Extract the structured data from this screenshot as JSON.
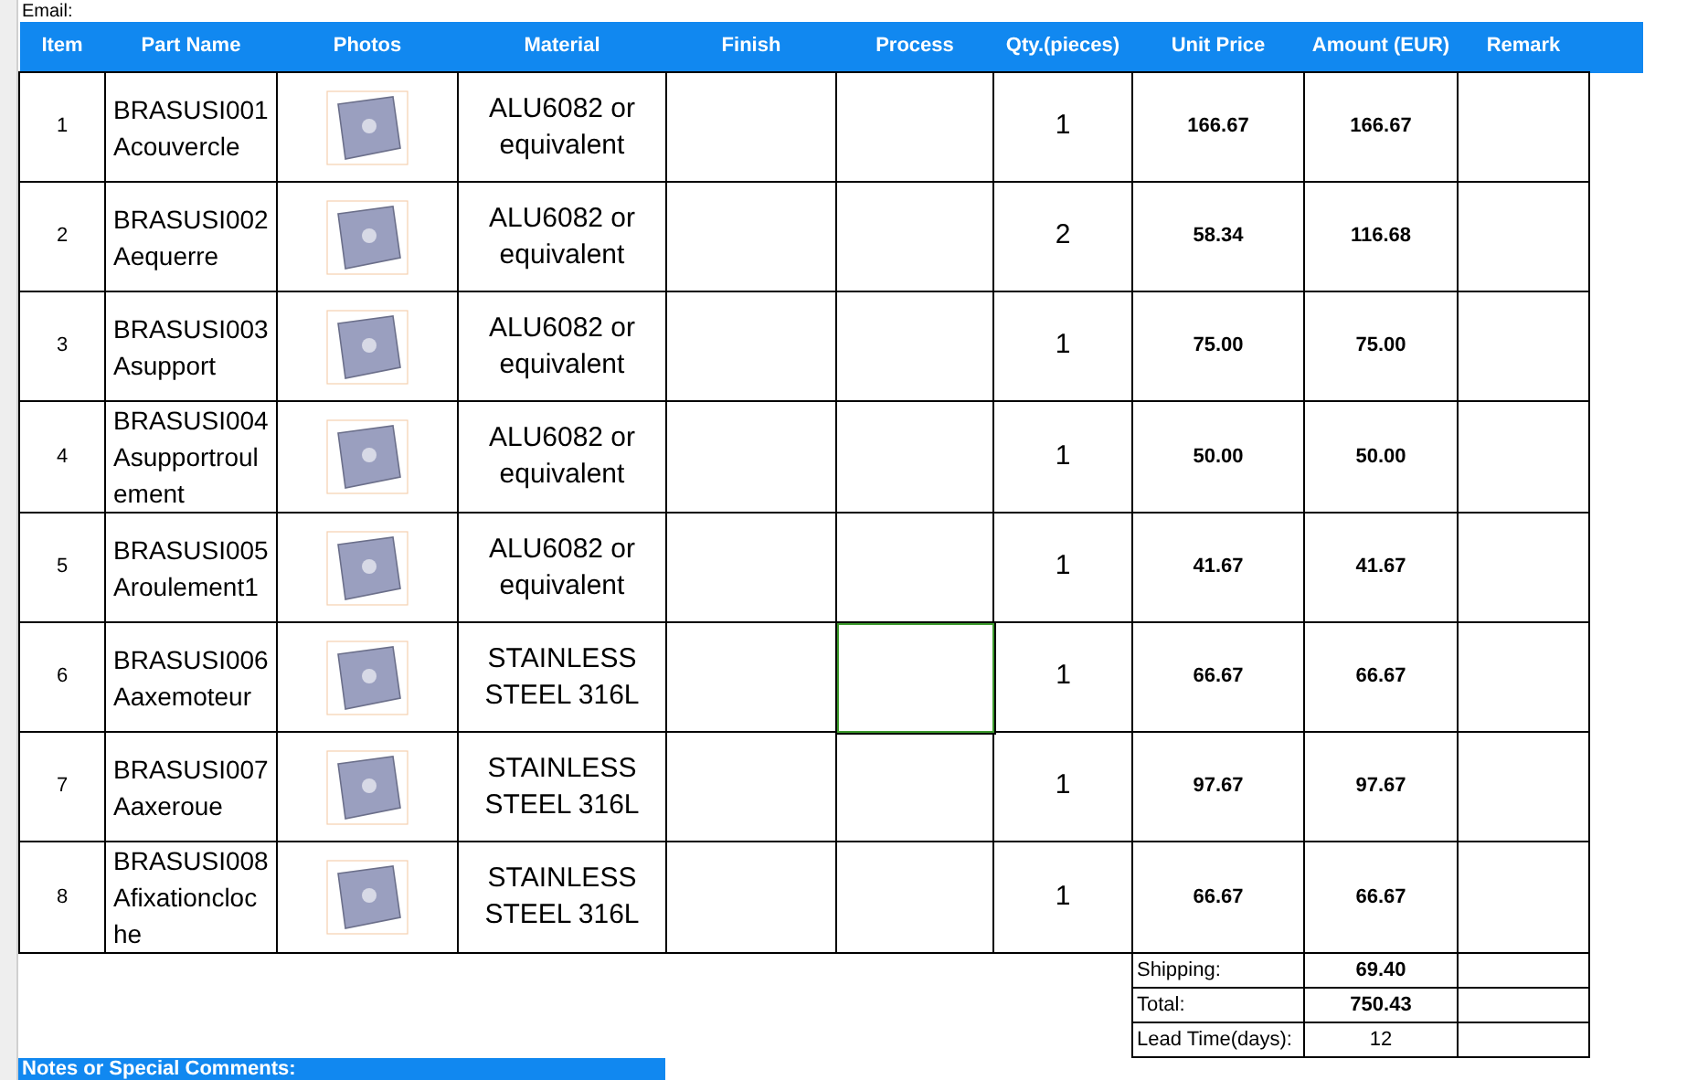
{
  "top_label": "Email:",
  "columns": [
    "Item",
    "Part Name",
    "Photos",
    "Material",
    "Finish",
    "Process",
    "Qty.(pieces)",
    "Unit Price",
    "Amount (EUR)",
    "Remark"
  ],
  "rows": [
    {
      "item": "1",
      "part_name": "BRASUSI001Acouvercle",
      "material": "ALU6082 or equivalent",
      "qty": "1",
      "unit_price": "166.67",
      "amount": "166.67",
      "process_selected": false
    },
    {
      "item": "2",
      "part_name": "BRASUSI002Aequerre",
      "material": "ALU6082 or equivalent",
      "qty": "2",
      "unit_price": "58.34",
      "amount": "116.68",
      "process_selected": false
    },
    {
      "item": "3",
      "part_name": "BRASUSI003Asupport",
      "material": "ALU6082 or equivalent",
      "qty": "1",
      "unit_price": "75.00",
      "amount": "75.00",
      "process_selected": false
    },
    {
      "item": "4",
      "part_name": "BRASUSI004Asupportroulement",
      "material": "ALU6082 or equivalent",
      "qty": "1",
      "unit_price": "50.00",
      "amount": "50.00",
      "process_selected": false
    },
    {
      "item": "5",
      "part_name": "BRASUSI005Aroulement1",
      "material": "ALU6082 or equivalent",
      "qty": "1",
      "unit_price": "41.67",
      "amount": "41.67",
      "process_selected": false
    },
    {
      "item": "6",
      "part_name": "BRASUSI006Aaxemoteur",
      "material": "STAINLESS STEEL 316L",
      "qty": "1",
      "unit_price": "66.67",
      "amount": "66.67",
      "process_selected": true
    },
    {
      "item": "7",
      "part_name": "BRASUSI007Aaxeroue",
      "material": "STAINLESS STEEL 316L",
      "qty": "1",
      "unit_price": "97.67",
      "amount": "97.67",
      "process_selected": false
    },
    {
      "item": "8",
      "part_name": "BRASUSI008Afixationcloche",
      "material": "STAINLESS STEEL 316L",
      "qty": "1",
      "unit_price": "66.67",
      "amount": "66.67",
      "process_selected": false
    }
  ],
  "summary": [
    {
      "label": "Shipping:",
      "value": "69.40",
      "bold": true
    },
    {
      "label": "Total:",
      "value": "750.43",
      "bold": true
    },
    {
      "label": "Lead Time(days):",
      "value": "12",
      "bold": false
    }
  ],
  "notes_title": "Notes or Special Comments:"
}
